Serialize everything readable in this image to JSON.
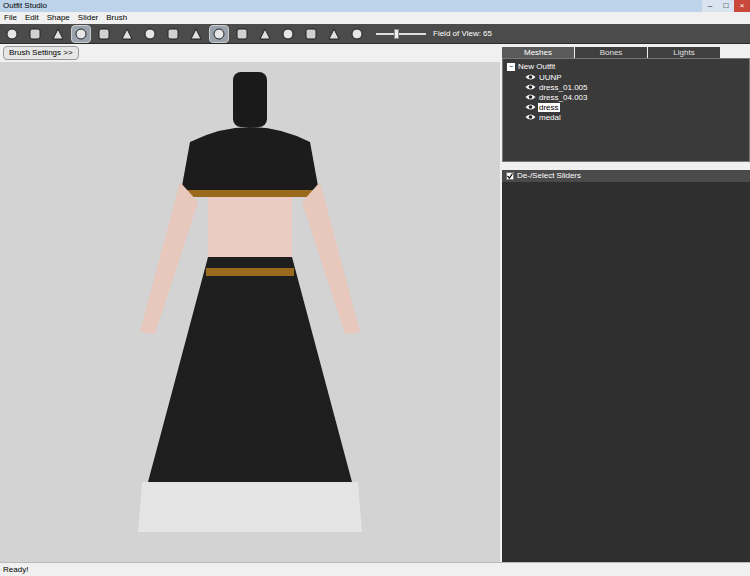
{
  "window": {
    "title": "Outfit Studio",
    "controls": [
      "–",
      "□",
      "×"
    ]
  },
  "menu": [
    "File",
    "Edit",
    "Shape",
    "Slider",
    "Brush"
  ],
  "toolbar": {
    "tools": [
      {
        "selected": false
      },
      {
        "selected": false
      },
      {
        "selected": false
      },
      {
        "selected": true
      },
      {
        "selected": false
      },
      {
        "selected": false
      },
      {
        "selected": false
      },
      {
        "selected": false
      },
      {
        "selected": false
      },
      {
        "selected": true
      },
      {
        "selected": false
      },
      {
        "selected": false
      },
      {
        "selected": false
      },
      {
        "selected": false
      },
      {
        "selected": false
      },
      {
        "selected": false
      }
    ],
    "fov": {
      "label": "Field of View: 65",
      "level": 0.4
    }
  },
  "brush_settings": {
    "label": "Brush Settings >>"
  },
  "tabs": [
    {
      "label": "Meshes",
      "selected": true
    },
    {
      "label": "Bones",
      "selected": false
    },
    {
      "label": "Lights",
      "selected": false
    }
  ],
  "tree": {
    "root": {
      "label": "New Outfit",
      "expanded": true,
      "toggle": "−"
    },
    "items": [
      {
        "label": "UUNP",
        "visible": true,
        "selected": false
      },
      {
        "label": "dress_01.005",
        "visible": true,
        "selected": false
      },
      {
        "label": "dress_04.003",
        "visible": true,
        "selected": false
      },
      {
        "label": "dress",
        "visible": true,
        "selected": true
      },
      {
        "label": "medal",
        "visible": true,
        "selected": false
      }
    ]
  },
  "sliders": {
    "label": "De-/Select Sliders",
    "checked": true
  },
  "status_bar": {
    "text": "Ready!"
  }
}
